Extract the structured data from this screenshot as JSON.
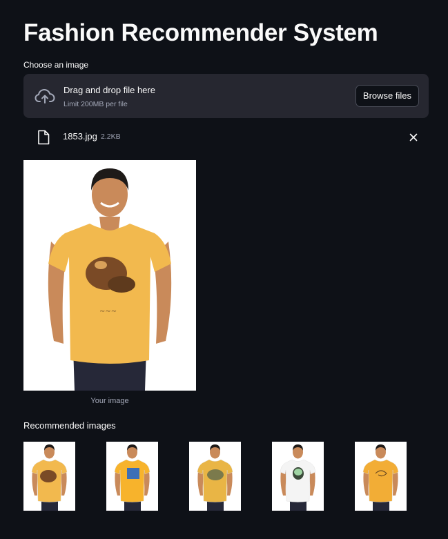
{
  "page": {
    "title": "Fashion Recommender System"
  },
  "uploader": {
    "label": "Choose an image",
    "drop_text": "Drag and drop file here",
    "limit_text": "Limit 200MB per file",
    "browse_label": "Browse files"
  },
  "uploaded_file": {
    "name": "1853.jpg",
    "size": "2.2KB"
  },
  "preview": {
    "caption": "Your image"
  },
  "recommendations": {
    "label": "Recommended images",
    "items": [
      {
        "shirt_color": "#f2b94e",
        "graphic": "brown-bear"
      },
      {
        "shirt_color": "#f7b32c",
        "graphic": "blue-print"
      },
      {
        "shirt_color": "#e9b545",
        "graphic": "olive-print"
      },
      {
        "shirt_color": "#f4f4f4",
        "graphic": "green-skull"
      },
      {
        "shirt_color": "#f2ad36",
        "graphic": "line-art"
      }
    ]
  },
  "colors": {
    "background": "#0e1117",
    "panel": "#262730",
    "text": "#fafafa",
    "muted_text": "#a3a8b8"
  }
}
